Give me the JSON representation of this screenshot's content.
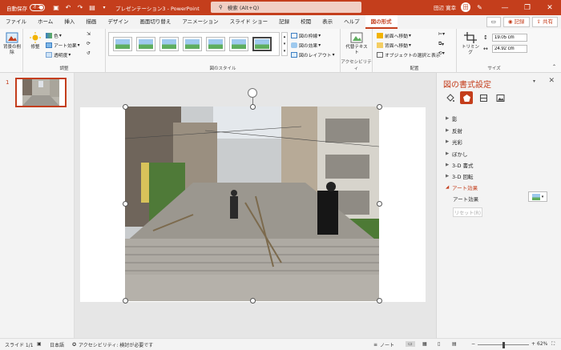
{
  "titlebar": {
    "autosave_label": "自動保存",
    "autosave_state": "オフ",
    "doc_title": "プレゼンテーション3 - PowerPoint",
    "search_placeholder": "検索 (Alt+Q)",
    "user_name": "田辺 寛幸",
    "user_initial": "田"
  },
  "tabs": [
    {
      "label": "ファイル"
    },
    {
      "label": "ホーム"
    },
    {
      "label": "挿入"
    },
    {
      "label": "描画"
    },
    {
      "label": "デザイン"
    },
    {
      "label": "画面切り替え"
    },
    {
      "label": "アニメーション"
    },
    {
      "label": "スライド ショー"
    },
    {
      "label": "記録"
    },
    {
      "label": "校閲"
    },
    {
      "label": "表示"
    },
    {
      "label": "ヘルプ"
    },
    {
      "label": "図の形式"
    }
  ],
  "tab_right": {
    "record": "記録",
    "share": "共有"
  },
  "ribbon": {
    "remove_bg": "背景の削除",
    "corrections": "修整",
    "color": "色",
    "art_effects": "アート効果",
    "transparency": "透明度",
    "group_adjust": "調整",
    "group_styles": "図のスタイル",
    "border": "図の枠線",
    "effects": "図の効果",
    "layout": "図のレイアウト",
    "alt_text": "代替テキスト",
    "group_access": "アクセシビリティ",
    "bring_forward": "前面へ移動",
    "send_backward": "背面へ移動",
    "selection_pane": "オブジェクトの選択と表示",
    "group_arrange": "配置",
    "crop": "トリミング",
    "height": "19.05 cm",
    "width": "24.92 cm",
    "group_size": "サイズ"
  },
  "thumbnails": [
    {
      "number": "1"
    }
  ],
  "panel": {
    "title": "図の書式設定",
    "sections": [
      {
        "label": "影",
        "open": false
      },
      {
        "label": "反射",
        "open": false
      },
      {
        "label": "光彩",
        "open": false
      },
      {
        "label": "ぼかし",
        "open": false
      },
      {
        "label": "3-D 書式",
        "open": false
      },
      {
        "label": "3-D 回転",
        "open": false
      },
      {
        "label": "アート効果",
        "open": true
      }
    ],
    "art_effect_label": "アート効果",
    "reset_label": "リセット(R)"
  },
  "status": {
    "slide": "スライド 1/1",
    "language": "日本語",
    "accessibility": "アクセシビリティ: 検討が必要です",
    "notes": "ノート",
    "zoom": "62%"
  },
  "colors": {
    "accent": "#c43e1c"
  }
}
